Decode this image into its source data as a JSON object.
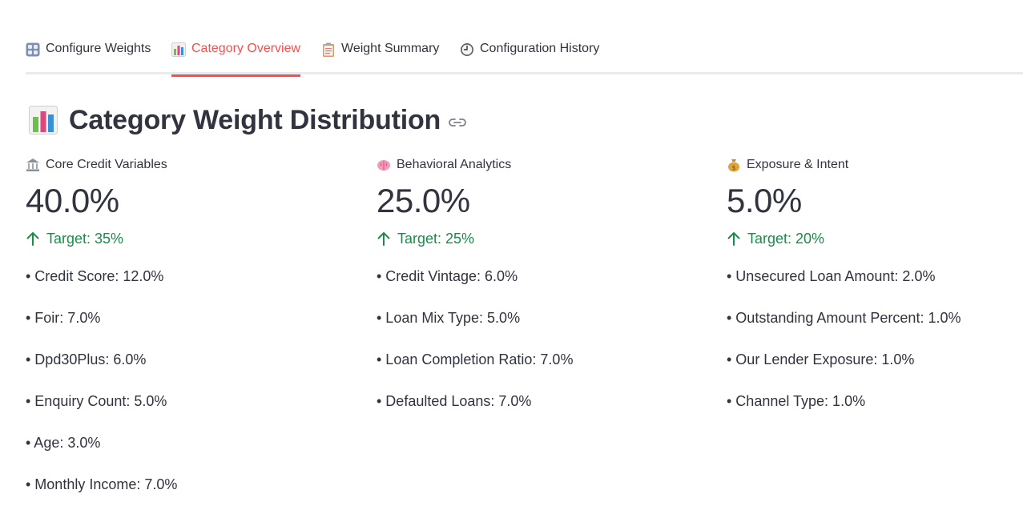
{
  "tabs": [
    {
      "label": "Configure Weights",
      "icon": "grid-icon",
      "active": false
    },
    {
      "label": "Category Overview",
      "icon": "bar-chart-icon",
      "active": true
    },
    {
      "label": "Weight Summary",
      "icon": "clipboard-icon",
      "active": false
    },
    {
      "label": "Configuration History",
      "icon": "clock-icon",
      "active": false
    }
  ],
  "page": {
    "title": "Category Weight Distribution",
    "title_icon": "bar-chart-icon",
    "anchor_icon": "link-icon"
  },
  "categories": [
    {
      "label": "Core Credit Variables",
      "icon": "bank-icon",
      "value": "40.0%",
      "delta": "Target: 35%",
      "items": [
        "• Credit Score: 12.0%",
        "• Foir: 7.0%",
        "• Dpd30Plus: 6.0%",
        "• Enquiry Count: 5.0%",
        "• Age: 3.0%",
        "• Monthly Income: 7.0%"
      ]
    },
    {
      "label": "Behavioral Analytics",
      "icon": "brain-icon",
      "value": "25.0%",
      "delta": "Target: 25%",
      "items": [
        "• Credit Vintage: 6.0%",
        "• Loan Mix Type: 5.0%",
        "• Loan Completion Ratio: 7.0%",
        "• Defaulted Loans: 7.0%"
      ]
    },
    {
      "label": "Exposure & Intent",
      "icon": "money-bag-icon",
      "value": "5.0%",
      "delta": "Target: 20%",
      "items": [
        "• Unsecured Loan Amount: 2.0%",
        "• Outstanding Amount Percent: 1.0%",
        "• Our Lender Exposure: 1.0%",
        "• Channel Type: 1.0%"
      ]
    }
  ],
  "colors": {
    "accent": "#ff4b4b",
    "positive": "#1d8a4a",
    "text": "#31333f",
    "divider": "#e9eaee"
  }
}
